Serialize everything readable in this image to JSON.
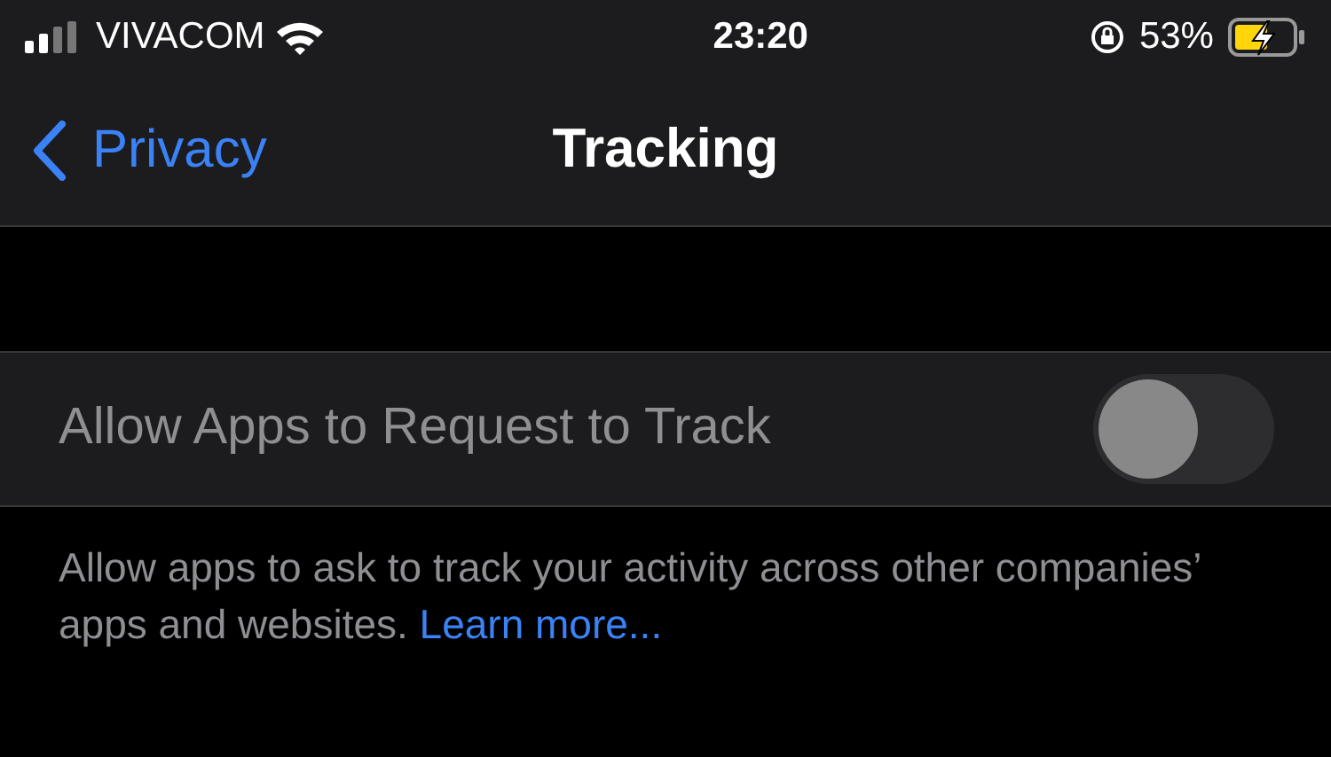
{
  "status_bar": {
    "carrier": "VIVACOM",
    "time": "23:20",
    "battery_percent": "53%",
    "charging": true
  },
  "nav": {
    "back": "Privacy",
    "title": "Tracking"
  },
  "setting": {
    "label": "Allow Apps to Request to Track",
    "on": false,
    "disabled": true
  },
  "footer": {
    "text": "Allow apps to ask to track your activity across other companies’ apps and websites.",
    "link": "Learn more..."
  }
}
